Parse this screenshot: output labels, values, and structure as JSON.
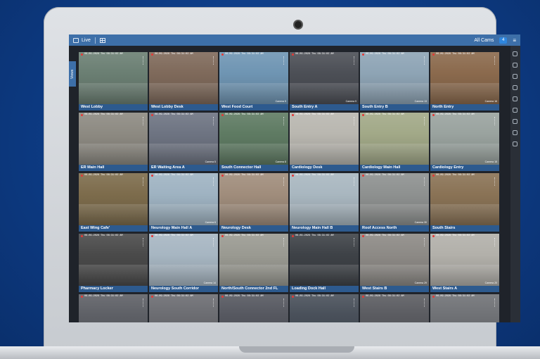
{
  "topbar": {
    "live_label": "Live",
    "right_label": "All Cams",
    "badge": "4",
    "menu_icon": "menu-icon"
  },
  "side_tab": {
    "label": "Views"
  },
  "colors": {
    "topbar": "#3d6fa8",
    "label_bar": "#2d5a8e",
    "screen_bg": "#1f232a",
    "background": "#0b3a82"
  },
  "rail_icons": [
    "monitor-icon",
    "search-icon",
    "pin-icon",
    "person-icon",
    "gear-icon",
    "alert-icon",
    "clock-icon",
    "chat-icon",
    "exit-icon"
  ],
  "timestamp": "06-09-2026  Thu 08:31:02 AM",
  "cameras": [
    {
      "name": "West Lobby",
      "tag": "",
      "tone": "#6b7f73"
    },
    {
      "name": "West Lobby Desk",
      "tag": "",
      "tone": "#7f6a5b"
    },
    {
      "name": "West Food Court",
      "tag": "Camera 5",
      "tone": "#6f95b3"
    },
    {
      "name": "South Entry A",
      "tag": "Camera 9",
      "tone": "#4c4f56"
    },
    {
      "name": "South Entry B",
      "tag": "Camera 13",
      "tone": "#8ea4b5"
    },
    {
      "name": "North Entry",
      "tag": "Camera 16",
      "tone": "#8b6a4d"
    },
    {
      "name": "ER Main Hall",
      "tag": "",
      "tone": "#8d8a82"
    },
    {
      "name": "ER Waiting Area A",
      "tag": "Camera 5",
      "tone": "#6e7482"
    },
    {
      "name": "South Connector Hall",
      "tag": "Camera 8",
      "tone": "#5f7b63"
    },
    {
      "name": "Cardiology Desk",
      "tag": "",
      "tone": "#b9b7b0"
    },
    {
      "name": "Cardiology Main Hall",
      "tag": "",
      "tone": "#a2a988"
    },
    {
      "name": "Cardiology Entry",
      "tag": "Camera 15",
      "tone": "#9aa39f"
    },
    {
      "name": "East Wing Cafe'",
      "tag": "",
      "tone": "#7d6c4c"
    },
    {
      "name": "Neurology Main Hall A",
      "tag": "Camera 6",
      "tone": "#9fb3c2"
    },
    {
      "name": "Neurology Desk",
      "tag": "",
      "tone": "#a08d7c"
    },
    {
      "name": "Neurology Main Hall B",
      "tag": "",
      "tone": "#a9b7c0"
    },
    {
      "name": "Roof Access North",
      "tag": "Camera 30",
      "tone": "#8e9190"
    },
    {
      "name": "South Stairs",
      "tag": "",
      "tone": "#8a7356"
    },
    {
      "name": "Pharmacy Locker",
      "tag": "",
      "tone": "#4a4a4a"
    },
    {
      "name": "Neurology South Corridor",
      "tag": "Camera 14",
      "tone": "#a7b6c2"
    },
    {
      "name": "North/South Connector 2nd FL",
      "tag": "",
      "tone": "#9a9a92"
    },
    {
      "name": "Loading Dock Hall",
      "tag": "",
      "tone": "#3e4247"
    },
    {
      "name": "West Stairs B",
      "tag": "Camera 29",
      "tone": "#8d8a86"
    },
    {
      "name": "West Stairs A",
      "tag": "Camera 20",
      "tone": "#b2b0aa"
    },
    {
      "name": "",
      "tag": "",
      "tone": "#5e6066"
    },
    {
      "name": "",
      "tag": "",
      "tone": "#6c6d72"
    },
    {
      "name": "",
      "tag": "",
      "tone": "#565860"
    },
    {
      "name": "",
      "tag": "",
      "tone": "#49505a"
    },
    {
      "name": "",
      "tag": "",
      "tone": "#5b5c61"
    },
    {
      "name": "",
      "tag": "",
      "tone": "#707276"
    }
  ]
}
